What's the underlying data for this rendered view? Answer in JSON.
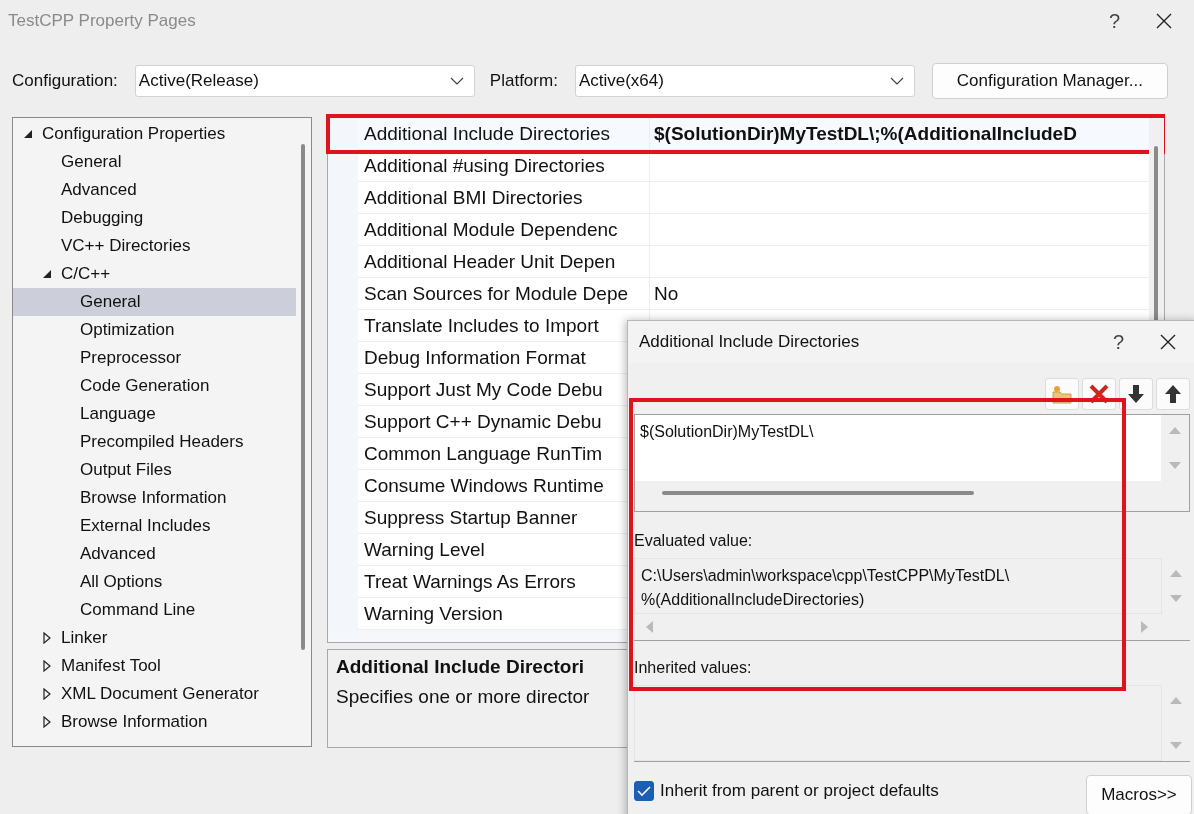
{
  "window": {
    "title": "TestCPP Property Pages",
    "help": "?"
  },
  "configuration": {
    "label": "Configuration:",
    "value": "Active(Release)"
  },
  "platform": {
    "label": "Platform:",
    "value": "Active(x64)"
  },
  "config_manager_button": "Configuration Manager...",
  "tree": [
    {
      "label": "Configuration Properties",
      "expanded": true,
      "selected": false,
      "children": [
        {
          "label": "General",
          "selected": false
        },
        {
          "label": "Advanced",
          "selected": false
        },
        {
          "label": "Debugging",
          "selected": false
        },
        {
          "label": "VC++ Directories",
          "selected": false
        },
        {
          "label": "C/C++",
          "expanded": true,
          "selected": false,
          "children": [
            {
              "label": "General",
              "selected": true
            },
            {
              "label": "Optimization",
              "selected": false
            },
            {
              "label": "Preprocessor",
              "selected": false
            },
            {
              "label": "Code Generation",
              "selected": false
            },
            {
              "label": "Language",
              "selected": false
            },
            {
              "label": "Precompiled Headers",
              "selected": false
            },
            {
              "label": "Output Files",
              "selected": false
            },
            {
              "label": "Browse Information",
              "selected": false
            },
            {
              "label": "External Includes",
              "selected": false
            },
            {
              "label": "Advanced",
              "selected": false
            },
            {
              "label": "All Options",
              "selected": false
            },
            {
              "label": "Command Line",
              "selected": false
            }
          ]
        },
        {
          "label": "Linker",
          "expanded": false,
          "selected": false
        },
        {
          "label": "Manifest Tool",
          "expanded": false,
          "selected": false
        },
        {
          "label": "XML Document Generator",
          "expanded": false,
          "selected": false
        },
        {
          "label": "Browse Information",
          "expanded": false,
          "selected": false
        }
      ]
    }
  ],
  "properties": [
    {
      "name": "Additional Include Directories",
      "value": "$(SolutionDir)MyTestDL\\;%(AdditionalIncludeD",
      "modified": true,
      "annotated": true
    },
    {
      "name": "Additional #using Directories",
      "annotated": false
    },
    {
      "name": "Additional BMI Directories",
      "annotated": false
    },
    {
      "name": "Additional Module Dependenc",
      "annotated": false
    },
    {
      "name": "Additional Header Unit Depen",
      "annotated": false
    },
    {
      "name": "Scan Sources for Module Depe",
      "value": "No",
      "modified": false,
      "annotated": false
    },
    {
      "name": "Translate Includes to Import",
      "annotated": false
    },
    {
      "name": "Debug Information Format",
      "annotated": false
    },
    {
      "name": "Support Just My Code Debu",
      "annotated": false
    },
    {
      "name": "Support C++ Dynamic Debu",
      "annotated": false
    },
    {
      "name": "Common Language RunTim",
      "annotated": false
    },
    {
      "name": "Consume Windows Runtime",
      "annotated": false
    },
    {
      "name": "Suppress Startup Banner",
      "annotated": false
    },
    {
      "name": "Warning Level",
      "annotated": false
    },
    {
      "name": "Treat Warnings As Errors",
      "annotated": false
    },
    {
      "name": "Warning Version",
      "annotated": false
    }
  ],
  "description": {
    "title": "Additional Include Directori",
    "text": "Specifies one or more director"
  },
  "dialog": {
    "title": "Additional Include Directories",
    "help": "?",
    "annotated": true,
    "entries": [
      "$(SolutionDir)MyTestDL\\"
    ],
    "evaluated_label": "Evaluated value:",
    "evaluated_lines": [
      "C:\\Users\\admin\\workspace\\cpp\\TestCPP\\MyTestDL\\",
      "%(AdditionalIncludeDirectories)"
    ],
    "inherited_label": "Inherited values:",
    "inherit": {
      "label": "Inherit from parent or project defaults",
      "checked": true
    },
    "macros_button": "Macros>>"
  }
}
